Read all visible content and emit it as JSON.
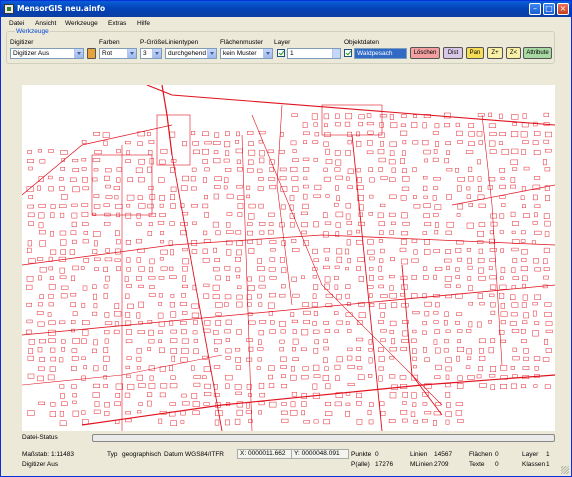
{
  "window": {
    "title": "MensorGIS neu.ainfo"
  },
  "menu": [
    "Datei",
    "Ansicht",
    "Werkzeuge",
    "Extras",
    "Hilfe"
  ],
  "toolbar": {
    "group_label": "Werkzeuge",
    "digitizer": {
      "label": "Digitizer",
      "value": "Digitizer Aus"
    },
    "colors": {
      "label": "Farben",
      "value": "Rot"
    },
    "point_size": {
      "label": "P-Größe",
      "value": "3"
    },
    "line_types": {
      "label": "Linientypen",
      "value": "durchgehend"
    },
    "area_pattern": {
      "label": "Flächenmuster",
      "value": "kein Muster"
    },
    "layer": {
      "label": "Layer",
      "value": "1"
    },
    "object_data": {
      "label": "Objektdaten",
      "value": "Waldpesach"
    },
    "buttons": {
      "delete": "Löschen",
      "dist": "Dist",
      "pan": "Pan",
      "zoom_in": "Z+",
      "zoom_fit": "Z<",
      "attribute": "Attribute"
    },
    "colors_accent": {
      "delete_bg": "#f2a0a0",
      "dist_bg": "#d9c7e8",
      "pan_bg": "#f5dd55",
      "zoom_bg": "#f7f0a6",
      "attr_bg": "#a9d9a3"
    }
  },
  "map": {
    "line_color": "#e0121e"
  },
  "status": {
    "label": "Datei-Status",
    "scale_label": "Maßstab:",
    "scale_value": "1:11483",
    "mode": "Digitizer Aus",
    "type_label": "Typ",
    "type_value": "geographisch",
    "datum_label": "Datum",
    "datum_value": "WGS84/ITFR",
    "x_label": "X:",
    "x_value": "0000011.662",
    "y_label": "Y:",
    "y_value": "0000048.091",
    "points_label": "Punkte",
    "points_value": "0",
    "pall_label": "P(alle)",
    "pall_value": "17276",
    "lines_label": "Linien",
    "lines_value": "14567",
    "mlines_label": "MLinien",
    "mlines_value": "2709",
    "areas_label": "Flächen",
    "areas_value": "0",
    "texts_label": "Texte",
    "texts_value": "0",
    "layer_label": "Layer",
    "layer_value": "1",
    "classes_label": "Klassen",
    "classes_value": "1"
  }
}
